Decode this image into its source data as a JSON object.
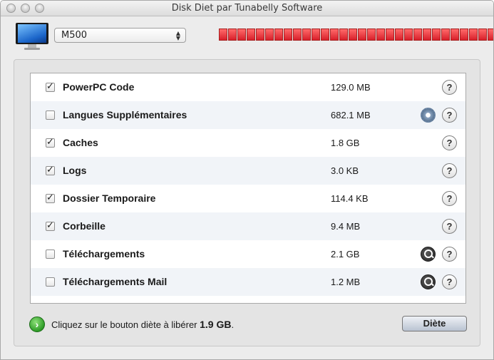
{
  "window": {
    "title": "Disk Diet par Tunabelly Software"
  },
  "disk": {
    "selected": "M500"
  },
  "usage": {
    "filled_segments": 34,
    "total_segments": 37
  },
  "items": [
    {
      "label": "PowerPC Code",
      "size": "129.0 MB",
      "checked": true,
      "action_icon": ""
    },
    {
      "label": "Langues Supplémentaires",
      "size": "682.1 MB",
      "checked": false,
      "action_icon": "gear-icon"
    },
    {
      "label": "Caches",
      "size": "1.8 GB",
      "checked": true,
      "action_icon": ""
    },
    {
      "label": "Logs",
      "size": "3.0 KB",
      "checked": true,
      "action_icon": ""
    },
    {
      "label": "Dossier Temporaire",
      "size": "114.4 KB",
      "checked": true,
      "action_icon": ""
    },
    {
      "label": "Corbeille",
      "size": "9.4 MB",
      "checked": true,
      "action_icon": ""
    },
    {
      "label": "Téléchargements",
      "size": "2.1 GB",
      "checked": false,
      "action_icon": "magnifier-icon"
    },
    {
      "label": "Téléchargements Mail",
      "size": "1.2 MB",
      "checked": false,
      "action_icon": "magnifier-icon"
    }
  ],
  "help_symbol": "?",
  "footer": {
    "message": "Cliquez sur le bouton diète à libérer ",
    "amount": "1.9 GB",
    "suffix": ".",
    "go_symbol": "›"
  },
  "button": {
    "diet_label": "Diète"
  }
}
